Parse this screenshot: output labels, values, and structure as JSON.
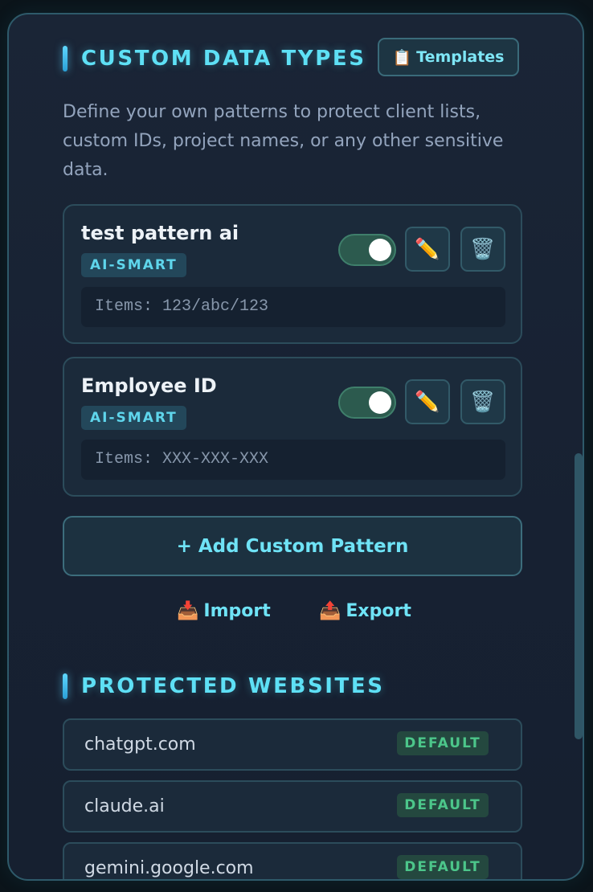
{
  "custom_types": {
    "title": "CUSTOM DATA TYPES",
    "templates_icon": "📋",
    "templates_label": "Templates",
    "description": "Define your own patterns to protect client lists, custom IDs, project names, or any other sensitive data.",
    "patterns": [
      {
        "name": "test pattern ai",
        "badge": "AI-SMART",
        "enabled": true,
        "items": "Items: 123/abc/123",
        "edit_icon": "✏️",
        "delete_icon": "🗑️"
      },
      {
        "name": "Employee ID",
        "badge": "AI-SMART",
        "enabled": true,
        "items": "Items: XXX-XXX-XXX",
        "edit_icon": "✏️",
        "delete_icon": "🗑️"
      }
    ],
    "add_label": "+ Add Custom Pattern",
    "import_icon": "📥",
    "import_label": "Import",
    "export_icon": "📤",
    "export_label": "Export"
  },
  "protected_sites": {
    "title": "PROTECTED WEBSITES",
    "sites": [
      {
        "domain": "chatgpt.com",
        "badge": "DEFAULT"
      },
      {
        "domain": "claude.ai",
        "badge": "DEFAULT"
      },
      {
        "domain": "gemini.google.com",
        "badge": "DEFAULT"
      }
    ]
  },
  "colors": {
    "accent": "#5ee0f5",
    "toggle_on": "#2c5a4e",
    "default_badge": "#4cc68a",
    "panel_border": "#2e5a6a"
  }
}
